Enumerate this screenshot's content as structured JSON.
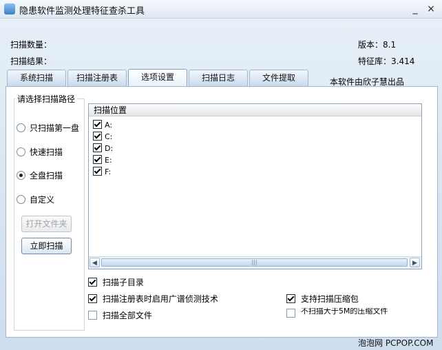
{
  "window": {
    "title": "隐患软件监测处理特征查杀工具",
    "minimize_glyph": "_",
    "close_glyph": "×"
  },
  "info": {
    "scan_count_label": "扫描数量：",
    "scan_result_label": "扫描结果：",
    "version_label": "版本：",
    "version_value": "8.1",
    "signature_label": "特征库：",
    "signature_value": "3.414"
  },
  "tabs": [
    {
      "label": "系统扫描"
    },
    {
      "label": "扫描注册表"
    },
    {
      "label": "选项设置",
      "active": true
    },
    {
      "label": "扫描日志"
    },
    {
      "label": "文件提取"
    }
  ],
  "credit": "本软件由欣子慧出品",
  "scan_path": {
    "group_label": "请选择扫描路径",
    "options": [
      {
        "label": "只扫描第一盘",
        "selected": false
      },
      {
        "label": "快速扫描",
        "selected": false
      },
      {
        "label": "全盘扫描",
        "selected": true
      },
      {
        "label": "自定义",
        "selected": false
      }
    ],
    "open_folder_label": "打开文件夹",
    "scan_now_label": "立即扫描"
  },
  "list": {
    "header": "扫描位置",
    "drives": [
      {
        "label": "A:",
        "checked": true
      },
      {
        "label": "C:",
        "checked": true
      },
      {
        "label": "D:",
        "checked": true
      },
      {
        "label": "E:",
        "checked": true
      },
      {
        "label": "F:",
        "checked": true
      }
    ],
    "scroll_grip": "|||"
  },
  "options": {
    "scan_subdirs": "扫描子目录",
    "registry_broad": "扫描注册表时启用广谱侦测技术",
    "scan_all_files": "扫描全部文件",
    "support_archive": "支持扫描压缩包",
    "skip_large_archive": "不扫描大于5M的压缩文件"
  },
  "footer": "泡泡网 PCPOP.COM"
}
